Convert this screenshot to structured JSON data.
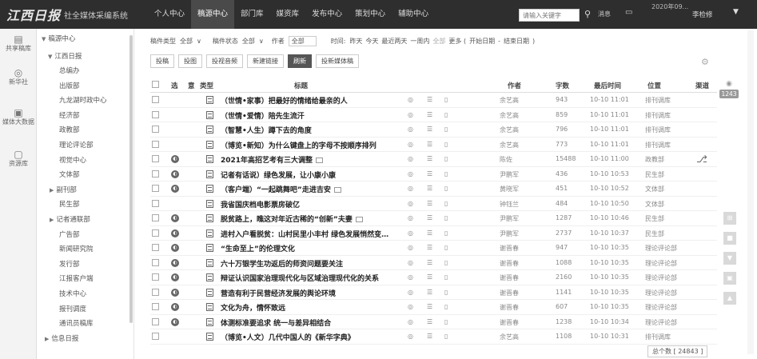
{
  "brand": "江西日报",
  "system_name": "社全媒体采编系统",
  "topnav": [
    "个人中心",
    "稿源中心",
    "部门库",
    "媒资库",
    "发布中心",
    "策划中心",
    "辅助中心"
  ],
  "topnav_active": 1,
  "search": {
    "placeholder": "请输入关键字"
  },
  "header_msg": "消息",
  "datetime": "2020年09...",
  "user": "李检修",
  "leftbar": [
    {
      "icon": "share-icon",
      "glyph": "▤",
      "label": "共享稿库"
    },
    {
      "icon": "news-agency-icon",
      "glyph": "◎",
      "label": "新华社"
    },
    {
      "icon": "media-data-icon",
      "glyph": "▣",
      "label": "媒体大数据"
    },
    {
      "icon": "resource-icon",
      "glyph": "▢",
      "label": "资源库"
    }
  ],
  "tree": {
    "root": "稿源中心",
    "group": "江西日报",
    "items": [
      "总编办",
      "出版部",
      "九龙湖时政中心",
      "经济部",
      "政教部",
      "理论评论部",
      "视觉中心",
      "文体部",
      "副刊部",
      "民生部",
      "记者通联部",
      "广告部",
      "新闻研究院",
      "发行部",
      "江报客户端",
      "技术中心",
      "报刊调度",
      "通讯员稿库",
      "信息日报"
    ],
    "collapsed": [
      "副刊部",
      "记者通联部",
      "信息日报"
    ]
  },
  "filter": {
    "type_label": "稿件类型",
    "type_value": "全部",
    "status_label": "稿件状态",
    "status_value": "全部",
    "author_label": "作者",
    "author_value": "全部",
    "time_label": "时间:",
    "time_options": [
      "昨天",
      "今天",
      "最近两天",
      "一周内",
      "全部",
      "更多 (",
      "开始日期",
      "-",
      "结束日期",
      ")"
    ]
  },
  "toolbar": [
    "投稿",
    "投图",
    "投视音频",
    "新建链接",
    "刷新",
    "投新媒体稿"
  ],
  "toolbar_active": 4,
  "columns": {
    "select": "选",
    "lock": "意",
    "type": "类型",
    "title": "标题",
    "author": "作者",
    "words": "字数",
    "time": "最后时间",
    "position": "位置",
    "channel": "渠道"
  },
  "rows": [
    {
      "lock": false,
      "title": "（世情•家事）把最好的情绪给最亲的人",
      "pic": false,
      "author": "余艺高",
      "words": "943",
      "time": "10-10 11:01",
      "position": "排刊调库"
    },
    {
      "lock": false,
      "title": "（世情•爱情）陪先生流汗",
      "pic": false,
      "author": "余艺高",
      "words": "859",
      "time": "10-10 11:01",
      "position": "排刊调库"
    },
    {
      "lock": false,
      "title": "（智慧•人生）蹲下去的角度",
      "pic": false,
      "author": "余艺高",
      "words": "796",
      "time": "10-10 11:01",
      "position": "排刊调库"
    },
    {
      "lock": false,
      "title": "（博览•新知）为什么键盘上的字母不按顺序排列",
      "pic": false,
      "author": "余艺高",
      "words": "773",
      "time": "10-10 11:01",
      "position": "排刊调库"
    },
    {
      "lock": true,
      "title": "2021年高招艺考有三大调整",
      "pic": true,
      "author": "陈佐",
      "words": "15488",
      "time": "10-10 11:00",
      "position": "政教部"
    },
    {
      "lock": true,
      "title": "记者有话说）绿色发展，让小康小康",
      "pic": false,
      "author": "尹鹏军",
      "words": "436",
      "time": "10-10 10:53",
      "position": "民生部"
    },
    {
      "lock": true,
      "title": "（客户端）“一起跳舞吧”走进吉安",
      "pic": true,
      "author": "黄晓军",
      "words": "451",
      "time": "10-10 10:52",
      "position": "文体部"
    },
    {
      "lock": false,
      "title": "我省国庆档电影票房破亿",
      "pic": false,
      "author": "钟钰兰",
      "words": "484",
      "time": "10-10 10:50",
      "position": "文体部"
    },
    {
      "lock": true,
      "title": "脱贫路上，瞧这对年近古稀的“创新”夫妻",
      "pic": true,
      "author": "尹鹏军",
      "words": "1287",
      "time": "10-10 10:46",
      "position": "民生部"
    },
    {
      "lock": true,
      "title": "进村入户看脱贫：山村民里小丰村 绿色发展悄然变…",
      "pic": false,
      "author": "尹鹏军",
      "words": "2737",
      "time": "10-10 10:37",
      "position": "民生部"
    },
    {
      "lock": true,
      "title": "“生命至上”的伦理文化",
      "pic": false,
      "author": "谢晋春",
      "words": "947",
      "time": "10-10 10:35",
      "position": "理论评论部"
    },
    {
      "lock": true,
      "title": "六十万银学生功返后的师资问题要关注",
      "pic": false,
      "author": "谢晋春",
      "words": "1088",
      "time": "10-10 10:35",
      "position": "理论评论部"
    },
    {
      "lock": true,
      "title": "辩证认识国家治理现代化与区域治理现代化的关系",
      "pic": false,
      "author": "谢晋春",
      "words": "2160",
      "time": "10-10 10:35",
      "position": "理论评论部"
    },
    {
      "lock": true,
      "title": "营造有利于民营经济发展的舆论环境",
      "pic": false,
      "author": "谢晋春",
      "words": "1141",
      "time": "10-10 10:35",
      "position": "理论评论部"
    },
    {
      "lock": true,
      "title": "文化为舟，情怀致远",
      "pic": false,
      "author": "谢晋春",
      "words": "607",
      "time": "10-10 10:35",
      "position": "理论评论部"
    },
    {
      "lock": true,
      "title": "体测标准要追求 统一与差异相结合",
      "pic": false,
      "author": "谢晋春",
      "words": "1238",
      "time": "10-10 10:34",
      "position": "理论评论部"
    },
    {
      "lock": false,
      "title": "（博览•人文）几代中国人的《新华字典》",
      "pic": false,
      "author": "余艺高",
      "words": "1108",
      "time": "10-10 10:31",
      "position": "排刊调库"
    }
  ],
  "side_badge": "1243",
  "total": "总个数 [ 24843 ]"
}
